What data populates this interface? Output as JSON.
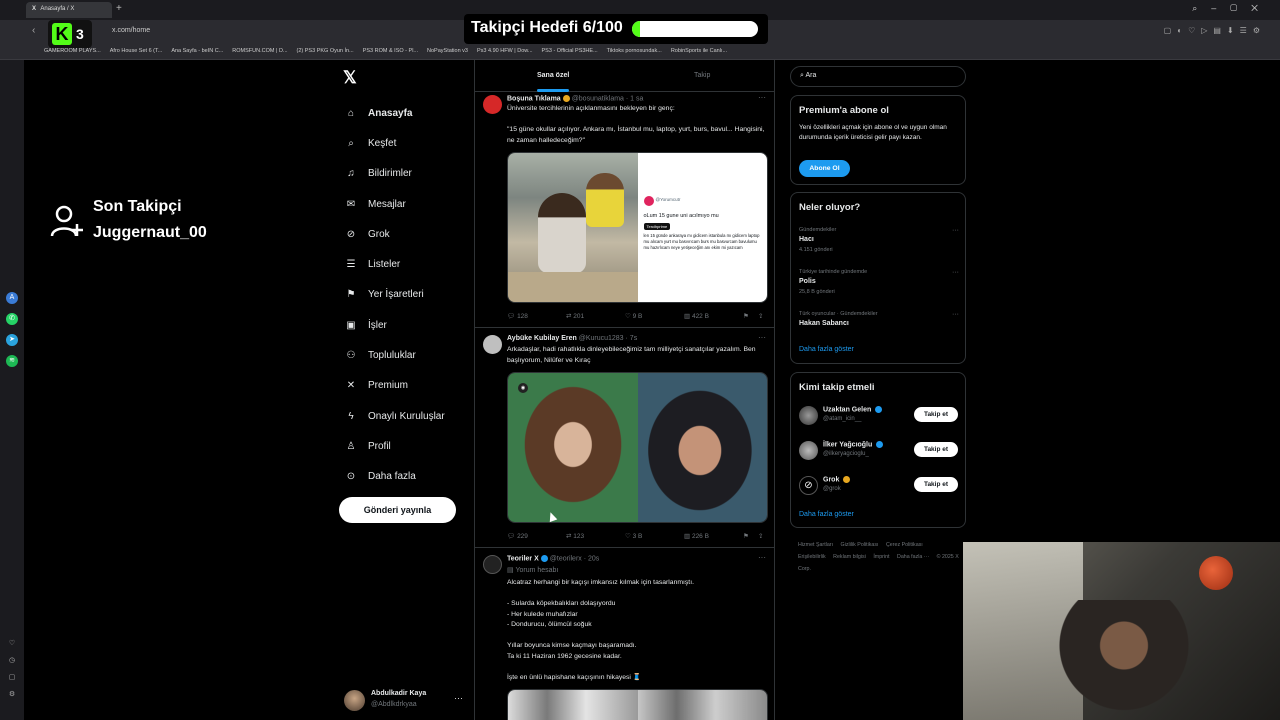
{
  "browser": {
    "tab_title": "Anasayfa / X",
    "tab_x": "X",
    "url": "x.com/home",
    "bookmarks": [
      "GAMEROOM PLAYS...",
      "Afro House Set 6 (T...",
      "Ana Sayfa - beIN C...",
      "ROMSFUN.COM | D...",
      "(2) PS3 PKG Oyun İn...",
      "PS3 ROM & ISO - Pl...",
      "NoPayStation v3",
      "Ps3 4.90 HFW | Dow...",
      "PS3 - Official PS3HE...",
      "Tiktoks pornosundak...",
      "RobinSports ile Canlı..."
    ]
  },
  "overlay": {
    "kick_letter": "K",
    "kick_count": "3",
    "goal_text": "Takipçi Hedefi 6/100",
    "goal_progress": 0.06,
    "goal_color": "#53fc18",
    "last_follower_title": "Son Takipçi",
    "last_follower_name": "Juggernaut_00"
  },
  "sidebar": {
    "items": [
      {
        "label": "Anasayfa",
        "icon": "home-icon",
        "glyph": "⌂"
      },
      {
        "label": "Keşfet",
        "icon": "search-icon",
        "glyph": "⌕"
      },
      {
        "label": "Bildirimler",
        "icon": "bell-icon",
        "glyph": "♫"
      },
      {
        "label": "Mesajlar",
        "icon": "mail-icon",
        "glyph": "✉"
      },
      {
        "label": "Grok",
        "icon": "grok-icon",
        "glyph": "⊘"
      },
      {
        "label": "Listeler",
        "icon": "list-icon",
        "glyph": "☰"
      },
      {
        "label": "Yer İşaretleri",
        "icon": "bookmark-icon",
        "glyph": "⚑"
      },
      {
        "label": "İşler",
        "icon": "briefcase-icon",
        "glyph": "▣"
      },
      {
        "label": "Topluluklar",
        "icon": "communities-icon",
        "glyph": "⚇"
      },
      {
        "label": "Premium",
        "icon": "x-icon",
        "glyph": "✕"
      },
      {
        "label": "Onaylı Kuruluşlar",
        "icon": "lightning-icon",
        "glyph": "ϟ"
      },
      {
        "label": "Profil",
        "icon": "profile-icon",
        "glyph": "♙"
      },
      {
        "label": "Daha fazla",
        "icon": "more-circle-icon",
        "glyph": "⊙"
      }
    ],
    "post_label": "Gönderi yayınla",
    "account_name": "Abdulkadir Kaya",
    "account_handle": "@Abdlkdrkyaa",
    "account_more": "···"
  },
  "timeline": {
    "tabs": [
      "Sana özel",
      "Takip"
    ],
    "tweets": [
      {
        "name": "Boşuna Tıklama",
        "handle": "@bosunatiklama · 1 sa",
        "text": "Üniversite tercihlerinin açıklanmasını bekleyen bir genç:\n\n\"15 güne okullar açılıyor. Ankara mı, İstanbul mu, laptop, yurt, burs, bavul... Hangisini, ne zaman halledeceğim?\"",
        "media_tweet_handle": "@Yorumcutr",
        "media_tweet_title": "oLum 15 gune uni acılmıyo mu",
        "media_tweet_tag": "Tercihprime",
        "media_tweet_body": "len 15 günde ankaraya mı gidicem istanbula mı gidicem laptop mu alıcam yurt mu basvırıcam burs mu basvurcam bavulumu mu hazırlıcam neye yetişeceğim anı ekim mi yazıcam",
        "stats": {
          "replies": "128",
          "reposts": "201",
          "likes": "9 B",
          "views": "422 B"
        }
      },
      {
        "name": "Aybüke Kubilay Eren",
        "handle": "@Kurucu1283 · 7s",
        "text": "Arkadaşlar, hadi rahatlıkla dinleyebileceğimiz tam milliyetçi sanatçılar yazalım. Ben başlıyorum, Nilüfer ve Kıraç",
        "stats": {
          "replies": "229",
          "reposts": "123",
          "likes": "3 B",
          "views": "226 B"
        }
      },
      {
        "name": "Teoriler X",
        "handle": "@teorilerx · 20s",
        "label": "Yorum hesabı",
        "text": "Alcatraz herhangi bir kaçışı imkansız kılmak için tasarlanmıştı.\n\n- Sularda köpekbalıkları dolaşıyordu\n- Her kulede muhafızlar\n- Dondurucu, ölümcül soğuk\n\nYıllar boyunca kimse kaçmayı başaramadı.\nTa ki 11 Haziran 1962 gecesine kadar.\n\nİşte en ünlü hapishane kaçışının hikayesi 🧵"
      }
    ]
  },
  "right": {
    "search_placeholder": "Ara",
    "premium_title": "Premium'a abone ol",
    "premium_text": "Yeni özellikleri açmak için abone ol ve uygun olman durumunda içerik üreticisi gelir payı kazan.",
    "subscribe_label": "Abone Ol",
    "trends_title": "Neler oluyor?",
    "trends": [
      {
        "category": "Gündemdekiler",
        "name": "Hacı",
        "count": "4.151 gönderi"
      },
      {
        "category": "Türkiye tarihinde gündemde",
        "name": "Polis",
        "count": "25,8 B gönderi"
      },
      {
        "category": "Türk oyuncular · Gündemdekiler",
        "name": "Hakan Sabancı",
        "count": ""
      }
    ],
    "show_more": "Daha fazla göster",
    "wtf_title": "Kimi takip etmeli",
    "follow_suggestions": [
      {
        "name": "Uzaktan Gelen",
        "handle": "@atam_icin__"
      },
      {
        "name": "İlker Yağcıoğlu",
        "handle": "@ilkeryagcioglu_"
      },
      {
        "name": "Grok",
        "handle": "@grok"
      }
    ],
    "follow_label": "Takip et",
    "footer": [
      "Hizmet Şartları",
      "Gizlilik Politikası",
      "Çerez Politikası",
      "Erişilebilirlik",
      "Reklam bilgisi",
      "İmprint",
      "Daha fazla ···",
      "© 2025 X Corp."
    ]
  }
}
